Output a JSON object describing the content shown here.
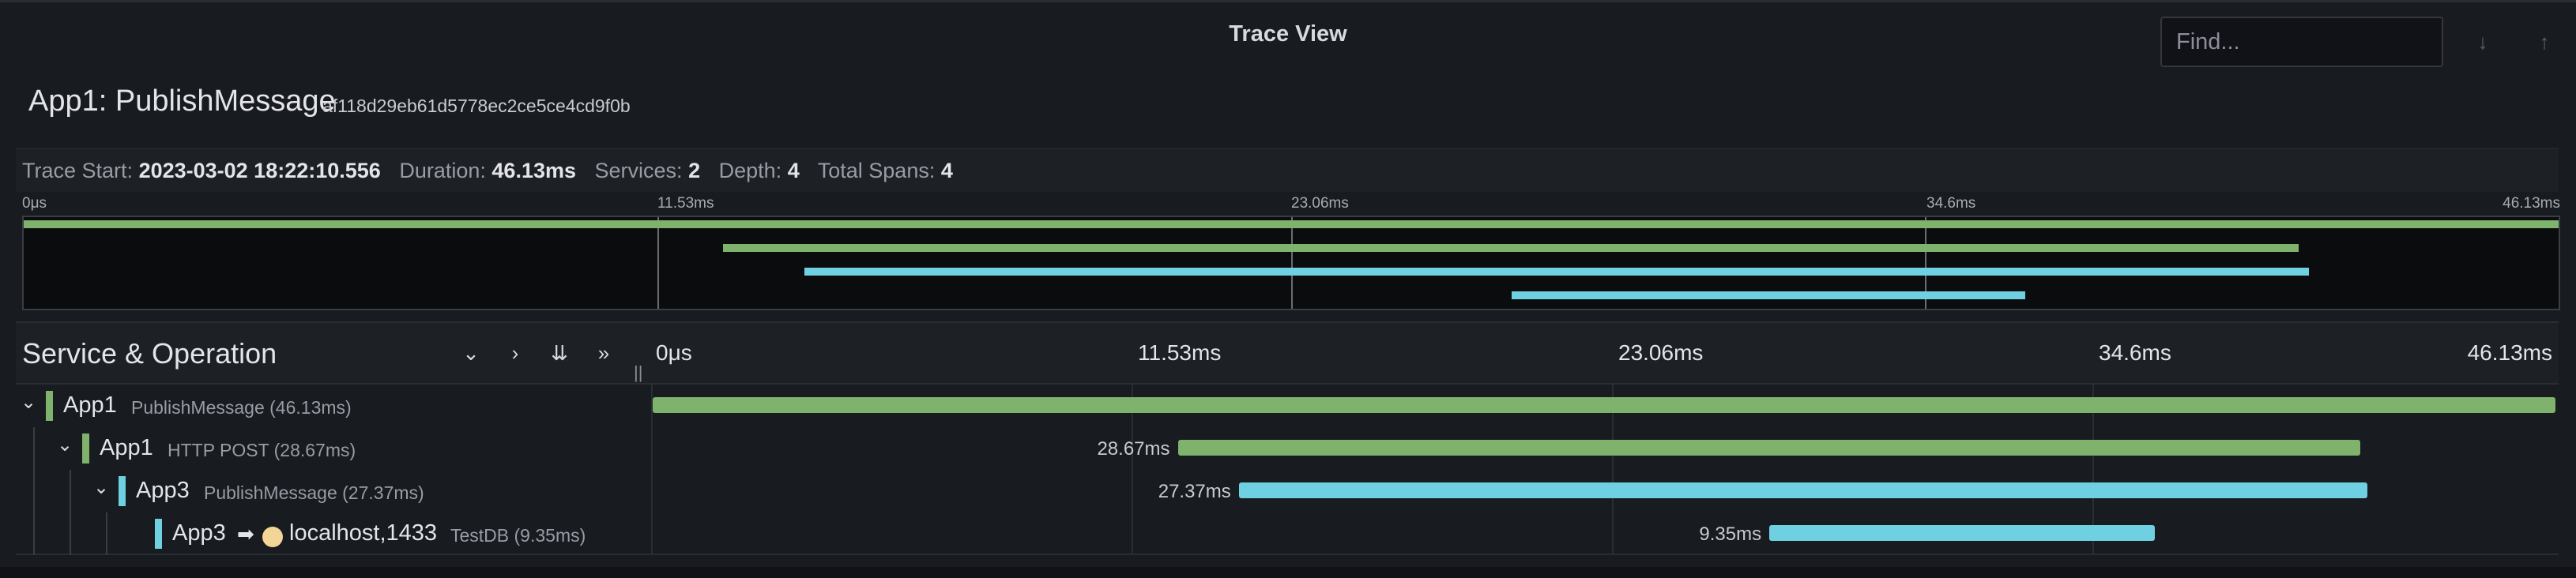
{
  "header": {
    "title": "Trace View",
    "find": {
      "placeholder": "Find...",
      "value": ""
    },
    "buttons": [
      {
        "name": "next-match",
        "icon": "arrow-down-icon"
      },
      {
        "name": "previous-match",
        "icon": "arrow-up-icon"
      }
    ]
  },
  "trace": {
    "title": "App1: PublishMessage",
    "id": "af118d29eb61d5778ec2ce5ce4cd9f0b",
    "stats": {
      "start_label": "Trace Start:",
      "start": "2023-03-02 18:22:10.556",
      "duration_label": "Duration:",
      "duration": "46.13ms",
      "services_label": "Services:",
      "services": "2",
      "depth_label": "Depth:",
      "depth": "4",
      "spans_label": "Total Spans:",
      "spans": "4"
    }
  },
  "timeline": {
    "ticks": [
      "0μs",
      "11.53ms",
      "23.06ms",
      "34.6ms",
      "46.13ms"
    ],
    "column_header": "Service & Operation",
    "controls": [
      {
        "name": "collapse-one",
        "icon": "chevron-down-icon"
      },
      {
        "name": "expand-one",
        "icon": "chevron-right-icon"
      },
      {
        "name": "collapse-all",
        "icon": "double-chevron-down-icon"
      },
      {
        "name": "expand-all",
        "icon": "double-chevron-right-icon"
      }
    ]
  },
  "colors": {
    "app1": "#7eb26d",
    "app3": "#6ed0e0",
    "db_icon": "#f4d598"
  },
  "spans": [
    {
      "service": "App1",
      "operation": "PublishMessage (46.13ms)",
      "duration": "46.13ms",
      "start_ms": 0,
      "end_ms": 46.13,
      "depth": 0,
      "color": "#7eb26d",
      "show_duration": false,
      "collapsible": true
    },
    {
      "service": "App1",
      "operation": "HTTP POST (28.67ms)",
      "duration": "28.67ms",
      "start_ms": 12.73,
      "end_ms": 41.4,
      "depth": 1,
      "color": "#7eb26d",
      "show_duration": true,
      "collapsible": true
    },
    {
      "service": "App3",
      "operation": "PublishMessage (27.37ms)",
      "duration": "27.37ms",
      "start_ms": 14.21,
      "end_ms": 41.58,
      "depth": 2,
      "color": "#6ed0e0",
      "show_duration": true,
      "collapsible": true
    },
    {
      "service": "App3",
      "peer": "localhost,1433",
      "operation": "TestDB (9.35ms)",
      "duration": "9.35ms",
      "start_ms": 27.07,
      "end_ms": 36.42,
      "depth": 3,
      "color": "#6ed0e0",
      "show_duration": true,
      "collapsible": false,
      "arrow_icon": "arrow-right-icon",
      "peer_icon": "database-icon"
    }
  ]
}
